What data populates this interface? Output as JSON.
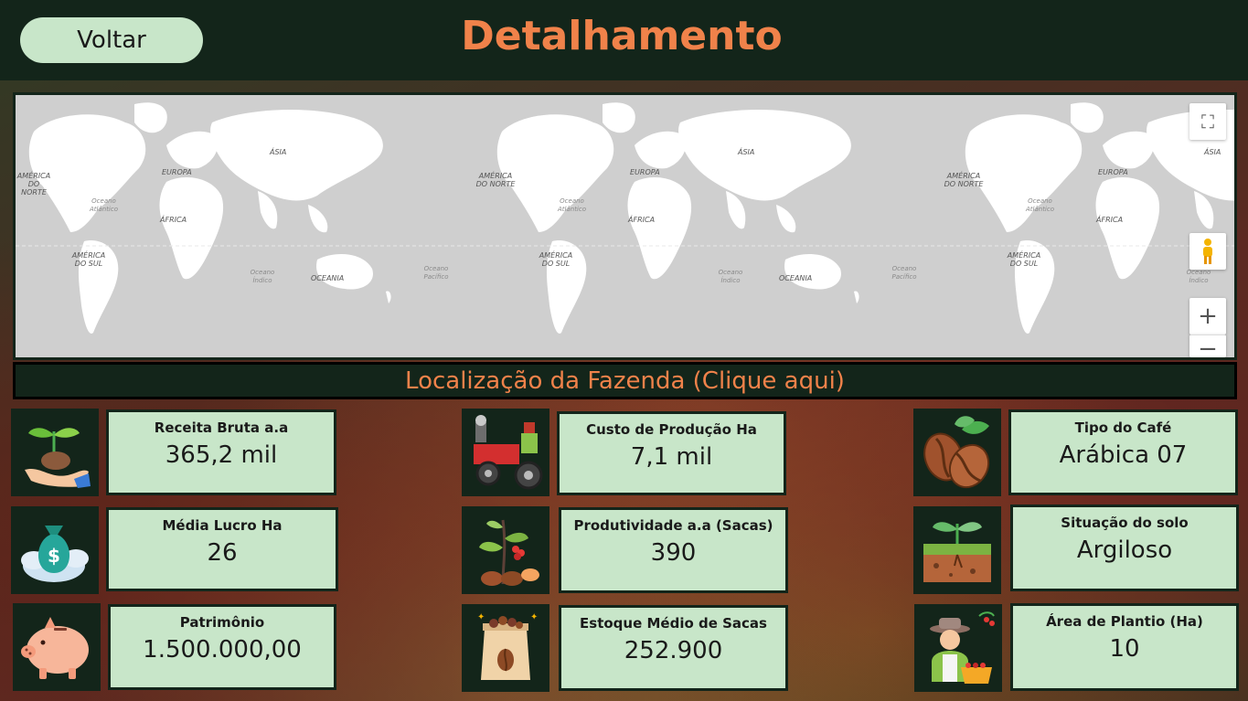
{
  "header": {
    "back_label": "Voltar",
    "title": "Detalhamento"
  },
  "map": {
    "labels": {
      "asia": "ÁSIA",
      "europe": "EUROPA",
      "north_america": "AMÉRICA DO NORTE",
      "south_america": "AMÉRICA DO SUL",
      "africa": "ÁFRICA",
      "oceania": "OCEANIA",
      "atlantic": "Oceano Atlântico",
      "indian": "Oceano Índico",
      "pacific": "Oceano Pacífico"
    },
    "controls": {
      "fullscreen": "⛶",
      "zoom_in": "+",
      "zoom_out": "−"
    },
    "location_link": "Localização da Fazenda (Clique aqui)"
  },
  "stats": {
    "receita": {
      "label": "Receita Bruta a.a",
      "value": "365,2 mil"
    },
    "custo": {
      "label": "Custo de Produção Ha",
      "value": "7,1 mil"
    },
    "tipo": {
      "label": "Tipo do Café",
      "value": "Arábica 07"
    },
    "lucro": {
      "label": "Média Lucro Ha",
      "value": "26"
    },
    "produtividade": {
      "label": "Produtividade a.a (Sacas)",
      "value": "390"
    },
    "solo": {
      "label": "Situação do solo",
      "value": "Argiloso"
    },
    "patrimonio": {
      "label": "Patrimônio",
      "value": "1.500.000,00"
    },
    "estoque": {
      "label": "Estoque Médio de Sacas",
      "value": "252.900"
    },
    "area": {
      "label": "Área de Plantio (Ha)",
      "value": "10"
    }
  },
  "icons": [
    "sprout-hand-icon",
    "tractor-icon",
    "coffee-beans-icon",
    "money-bag-icon",
    "coffee-plant-icon",
    "soil-sprout-icon",
    "piggy-bank-icon",
    "coffee-sack-icon",
    "farmer-icon"
  ]
}
